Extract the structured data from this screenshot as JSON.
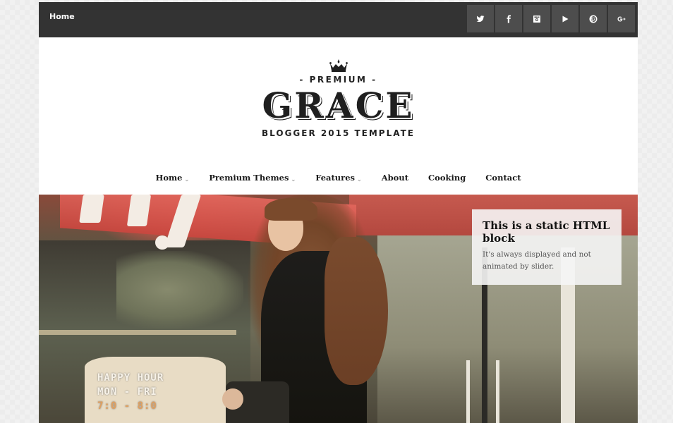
{
  "topbar": {
    "home_label": "Home",
    "social": [
      {
        "name": "twitter-icon",
        "label": "Twitter"
      },
      {
        "name": "facebook-icon",
        "label": "Facebook"
      },
      {
        "name": "instagram-icon",
        "label": "Instagram"
      },
      {
        "name": "youtube-icon",
        "label": "YouTube"
      },
      {
        "name": "pinterest-icon",
        "label": "Pinterest"
      },
      {
        "name": "google-plus-icon",
        "label": "Google+"
      }
    ]
  },
  "logo": {
    "premium": "- PREMIUM -",
    "title": "GRACE",
    "tagline": "BLOGGER 2015 TEMPLATE"
  },
  "nav": {
    "items": [
      {
        "label": "Home",
        "has_dropdown": true
      },
      {
        "label": "Premium Themes",
        "has_dropdown": true
      },
      {
        "label": "Features",
        "has_dropdown": true
      },
      {
        "label": "About",
        "has_dropdown": false
      },
      {
        "label": "Cooking",
        "has_dropdown": false
      },
      {
        "label": "Contact",
        "has_dropdown": false
      }
    ],
    "chevron": "⌄"
  },
  "hero": {
    "sign_rows": [
      "HAPPY HOUR",
      "MON - FRI",
      "7:0 - 8:0"
    ],
    "static_block": {
      "title": "This is a static HTML block",
      "text": "It's always displayed and not animated by slider."
    }
  },
  "colors": {
    "topbar_bg": "#333333",
    "social_btn_bg": "#4d4d4d",
    "text_dark": "#1a1a1a"
  }
}
